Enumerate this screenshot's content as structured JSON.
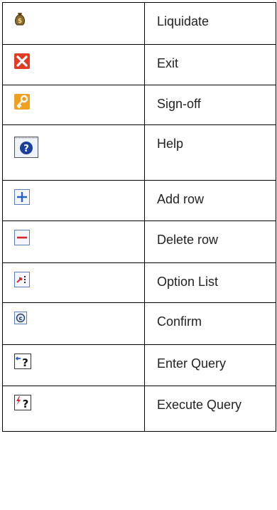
{
  "rows": [
    {
      "icon": "money-bag-icon",
      "label": "Liquidate"
    },
    {
      "icon": "close-icon",
      "label": "Exit"
    },
    {
      "icon": "key-icon",
      "label": "Sign-off"
    },
    {
      "icon": "help-icon",
      "label": "Help"
    },
    {
      "icon": "plus-icon",
      "label": "Add row"
    },
    {
      "icon": "minus-icon",
      "label": "Delete row"
    },
    {
      "icon": "option-list-icon",
      "label": "Option List"
    },
    {
      "icon": "confirm-icon",
      "label": "Confirm"
    },
    {
      "icon": "enter-query-icon",
      "label": "Enter Query"
    },
    {
      "icon": "execute-query-icon",
      "label": "Execute Query"
    }
  ],
  "colors": {
    "exit_red": "#e03b24",
    "key_orange": "#f0a020",
    "help_blue": "#1c3f9c",
    "plus_blue": "#2462c8",
    "minus_red": "#d8262b",
    "option_red": "#d8262b"
  }
}
